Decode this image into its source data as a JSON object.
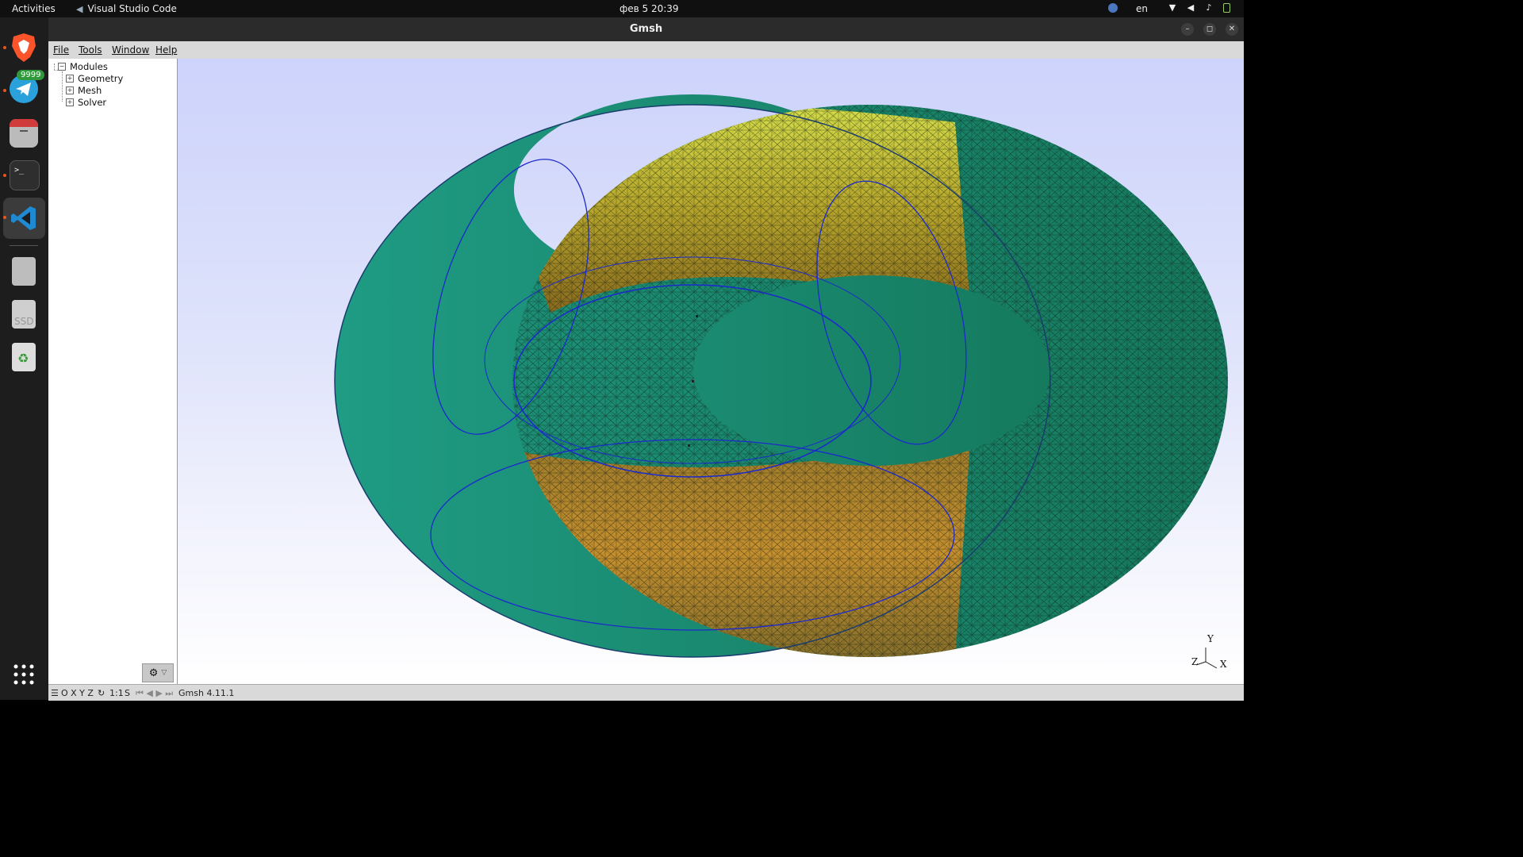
{
  "topbar": {
    "activities": "Activities",
    "app_name": "Visual Studio Code",
    "clock": "фев 5  20:39",
    "lang": "en"
  },
  "dock": {
    "telegram_badge": "9999",
    "drive_label": "SSD"
  },
  "window": {
    "title": "Gmsh"
  },
  "menu": {
    "file": "File",
    "tools": "Tools",
    "window": "Window",
    "help": "Help"
  },
  "tree": {
    "root": "Modules",
    "items": [
      "Geometry",
      "Mesh",
      "Solver"
    ]
  },
  "statusbar": {
    "axes": "O X Y Z",
    "scale": "1:1",
    "s": "S",
    "version": "Gmsh 4.11.1"
  },
  "axes_gizmo": {
    "x": "X",
    "y": "Y",
    "z": "Z"
  }
}
